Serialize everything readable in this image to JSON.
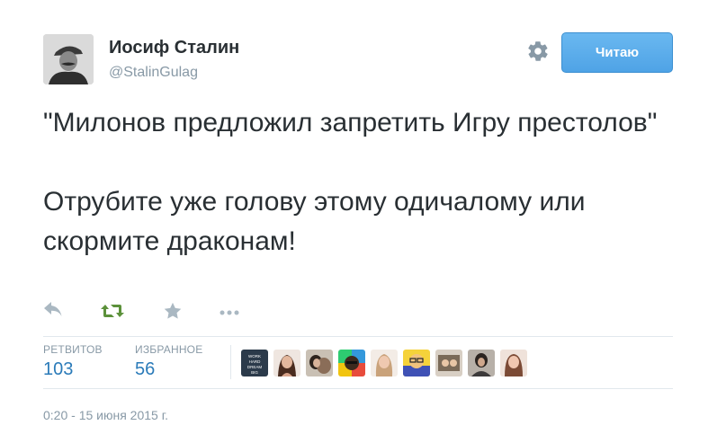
{
  "user": {
    "name": "Иосиф Сталин",
    "handle": "@StalinGulag"
  },
  "follow_button": {
    "label": "Читаю"
  },
  "tweet": {
    "line1": "\"Милонов предложил запретить Игру престолов\"",
    "line2": "Отрубите уже голову этому одичалому или скормите драконам!"
  },
  "stats": {
    "retweets_label": "РЕТВИТОВ",
    "retweets_value": "103",
    "favorites_label": "ИЗБРАННОЕ",
    "favorites_value": "56"
  },
  "mini_avatar_texts": {
    "first": "WORK HARD DREAM BIG"
  },
  "timestamp": "0:20 - 15 июня 2015 г.",
  "colors": {
    "accent": "#55acee",
    "retweet_green": "#5c913b",
    "muted": "#8899a6",
    "link": "#2b7bb9"
  },
  "icons": [
    "gear-icon",
    "reply-icon",
    "retweet-icon",
    "favorite-star-icon",
    "more-icon"
  ]
}
